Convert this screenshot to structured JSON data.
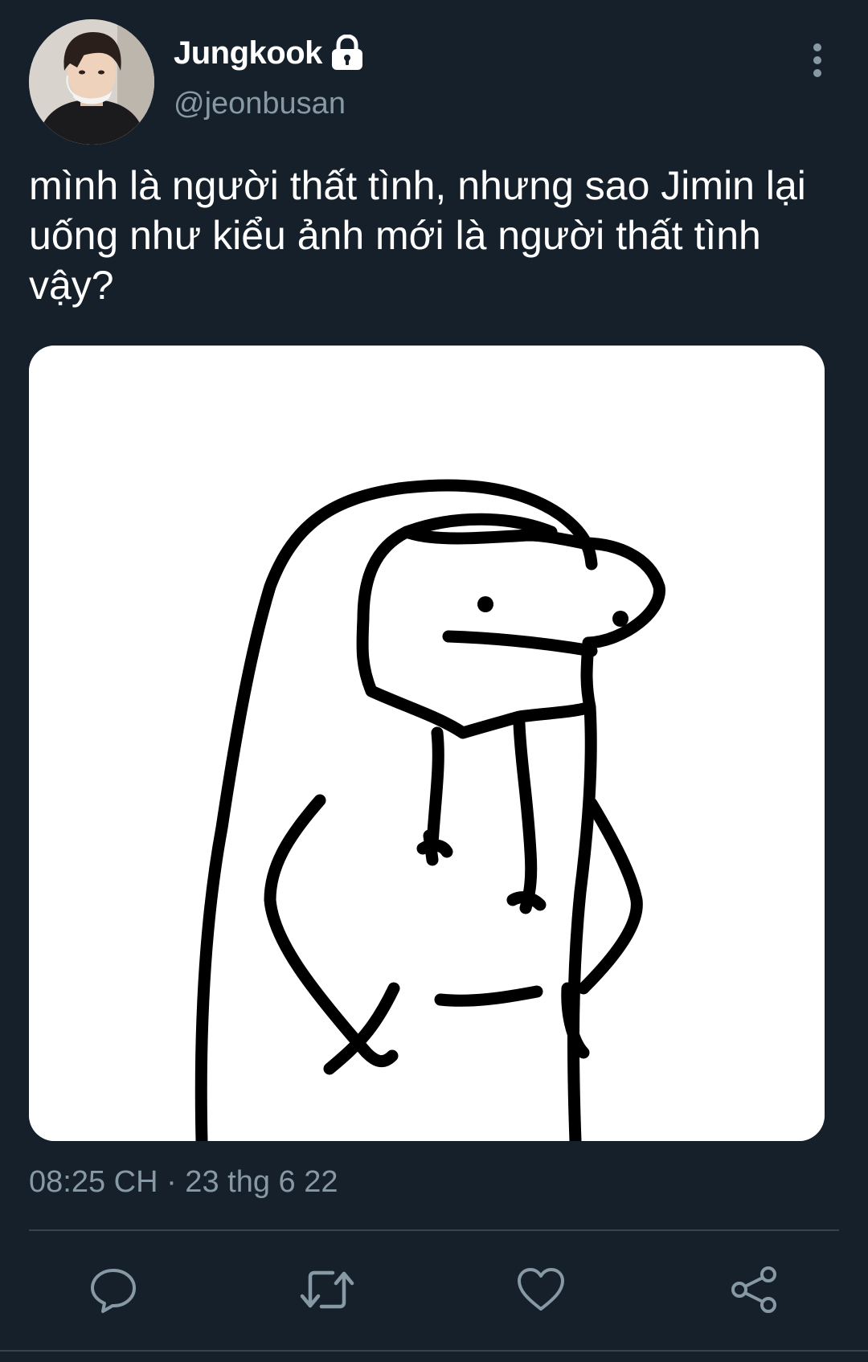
{
  "tweet": {
    "author": {
      "display_name": "Jungkook",
      "handle": "@jeonbusan",
      "protected_icon": "lock-icon"
    },
    "text": "mình là người thất tình, nhưng sao Jimin lại uống như kiểu ảnh mới là người thất tình vậy?",
    "timestamp": "08:25 CH · 23 thg 6 22",
    "media": {
      "icon": "meme-doodle-image"
    },
    "actions": {
      "reply_icon": "reply-icon",
      "retweet_icon": "retweet-icon",
      "like_icon": "heart-icon",
      "share_icon": "share-icon"
    },
    "more_icon": "more-vertical-icon"
  },
  "colors": {
    "background": "#15202b",
    "text_primary": "#ffffff",
    "text_secondary": "#8899a6",
    "divider": "#38444d"
  }
}
